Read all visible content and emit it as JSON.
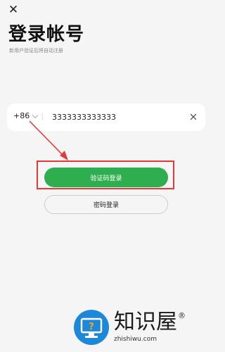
{
  "header": {
    "close_icon": "close-icon",
    "title": "登录帐号",
    "subtitle": "新用户验证后将自动注册"
  },
  "phone_field": {
    "country_code": "+86",
    "value": "3333333333333",
    "chevron_icon": "chevron-down-icon",
    "clear_icon": "clear-icon"
  },
  "buttons": {
    "sms_login": "验证码登录",
    "password_login": "密码登录"
  },
  "annotation": {
    "highlight_color": "#e53935"
  },
  "watermark": {
    "name": "知识屋",
    "reg_mark": "®",
    "url": "zhishiwu.com"
  },
  "colors": {
    "background": "#f5f5f5",
    "primary": "#2fae4f",
    "card": "#ffffff"
  }
}
